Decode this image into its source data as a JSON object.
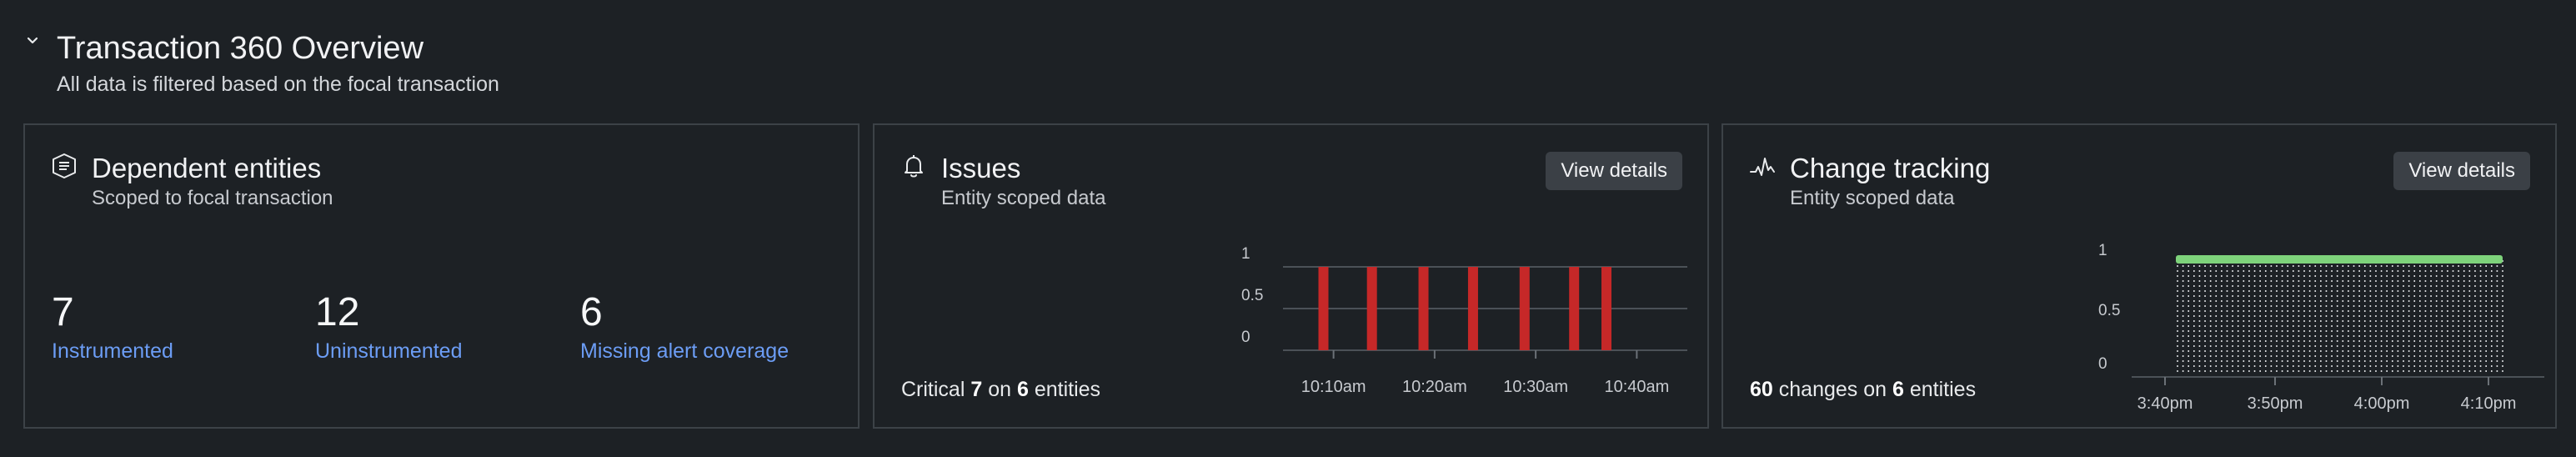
{
  "header": {
    "title": "Transaction 360 Overview",
    "subtitle": "All data is filtered based on the focal transaction"
  },
  "cards": {
    "dependent": {
      "title": "Dependent entities",
      "subtitle": "Scoped to focal transaction",
      "icon": "entity-list-icon",
      "metrics": [
        {
          "value": "7",
          "label": "Instrumented"
        },
        {
          "value": "12",
          "label": "Uninstrumented"
        },
        {
          "value": "6",
          "label": "Missing alert coverage"
        }
      ]
    },
    "issues": {
      "title": "Issues",
      "subtitle": "Entity scoped data",
      "icon": "bell-icon",
      "button": "View details",
      "summary": {
        "prefix": "Critical",
        "count": "7",
        "middle": "on",
        "entities": "6",
        "suffix": "entities"
      }
    },
    "changes": {
      "title": "Change tracking",
      "subtitle": "Entity scoped data",
      "icon": "activity-icon",
      "button": "View details",
      "summary": {
        "count": "60",
        "middle": "changes on",
        "entities": "6",
        "suffix": "entities"
      }
    }
  },
  "colors": {
    "accent_link": "#6c9df5",
    "issue_bar": "#c62828",
    "change_bar": "#7ed37b"
  },
  "chart_data": [
    {
      "type": "bar",
      "title": "",
      "x_ticks": [
        "10:10am",
        "10:20am",
        "10:30am",
        "10:40am"
      ],
      "y_ticks": [
        "0",
        "0.5",
        "1"
      ],
      "ylim": [
        0,
        1
      ],
      "x_minutes_range": [
        5,
        45
      ],
      "bars_at_minutes": [
        9,
        13.8,
        18.9,
        23.8,
        28.9,
        33.8,
        37
      ],
      "values": [
        1,
        1,
        1,
        1,
        1,
        1,
        1
      ],
      "series": [
        {
          "values": [
            1,
            1,
            1,
            1,
            1,
            1,
            1
          ]
        }
      ]
    },
    {
      "type": "bar",
      "title": "",
      "x_ticks": [
        "3:40pm",
        "3:50pm",
        "4:00pm",
        "4:10pm"
      ],
      "y_ticks": [
        "0",
        "0.5",
        "1"
      ],
      "ylim": [
        0,
        1
      ],
      "change_count": 60,
      "value": 1
    }
  ]
}
